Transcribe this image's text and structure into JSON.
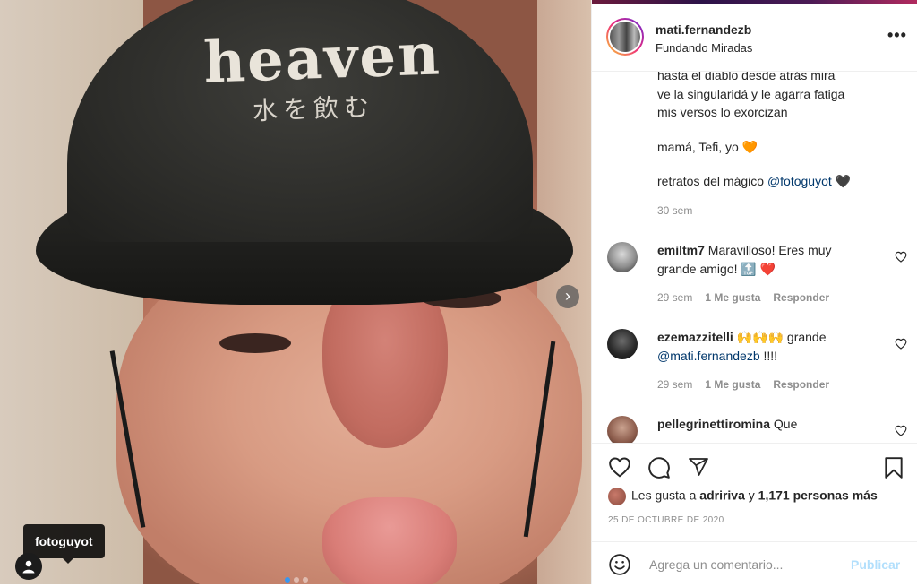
{
  "post": {
    "photo": {
      "hat_text": "heaven",
      "hat_text_jp": "水を飲む",
      "tag_label": "fotoguyot",
      "carousel_total": 3,
      "carousel_active": 1
    }
  },
  "header": {
    "username": "mati.fernandezb",
    "subtitle": "Fundando Miradas",
    "more": "•••"
  },
  "caption": {
    "line1": "hasta el diablo desde atrás mira",
    "line2": "ve la singularidá y le agarra fatiga",
    "line3": "mis versos lo exorcizan",
    "line4": "mamá, Tefi, yo 🧡",
    "line5_prefix": "retratos del mágico ",
    "line5_mention": "@fotoguyot",
    "line5_suffix": " 🖤",
    "time": "30 sem"
  },
  "comments": [
    {
      "user": "emiltm7",
      "text": " Maravilloso! Eres muy grande amigo! 🔝 ❤️",
      "time": "29 sem",
      "likes": "1 Me gusta",
      "reply": "Responder"
    },
    {
      "user": "ezemazzitelli",
      "text": " 🙌🙌🙌 grande ",
      "mention": "@mati.fernandezb",
      "suffix": " !!!!",
      "time": "29 sem",
      "likes": "1 Me gusta",
      "reply": "Responder"
    },
    {
      "user": "pellegrinettiromina",
      "text": " Que"
    }
  ],
  "likes": {
    "prefix": "Les gusta a ",
    "user": "adririva",
    "middle": " y ",
    "count": "1,171 personas más"
  },
  "date": "25 DE OCTUBRE DE 2020",
  "add_comment": {
    "placeholder": "Agrega un comentario...",
    "publish": "Publicar"
  },
  "colors": {
    "link": "#00376b",
    "muted": "#8e8e8e",
    "publish_disabled": "#b2dffc",
    "heart_red": "#ed4956"
  }
}
